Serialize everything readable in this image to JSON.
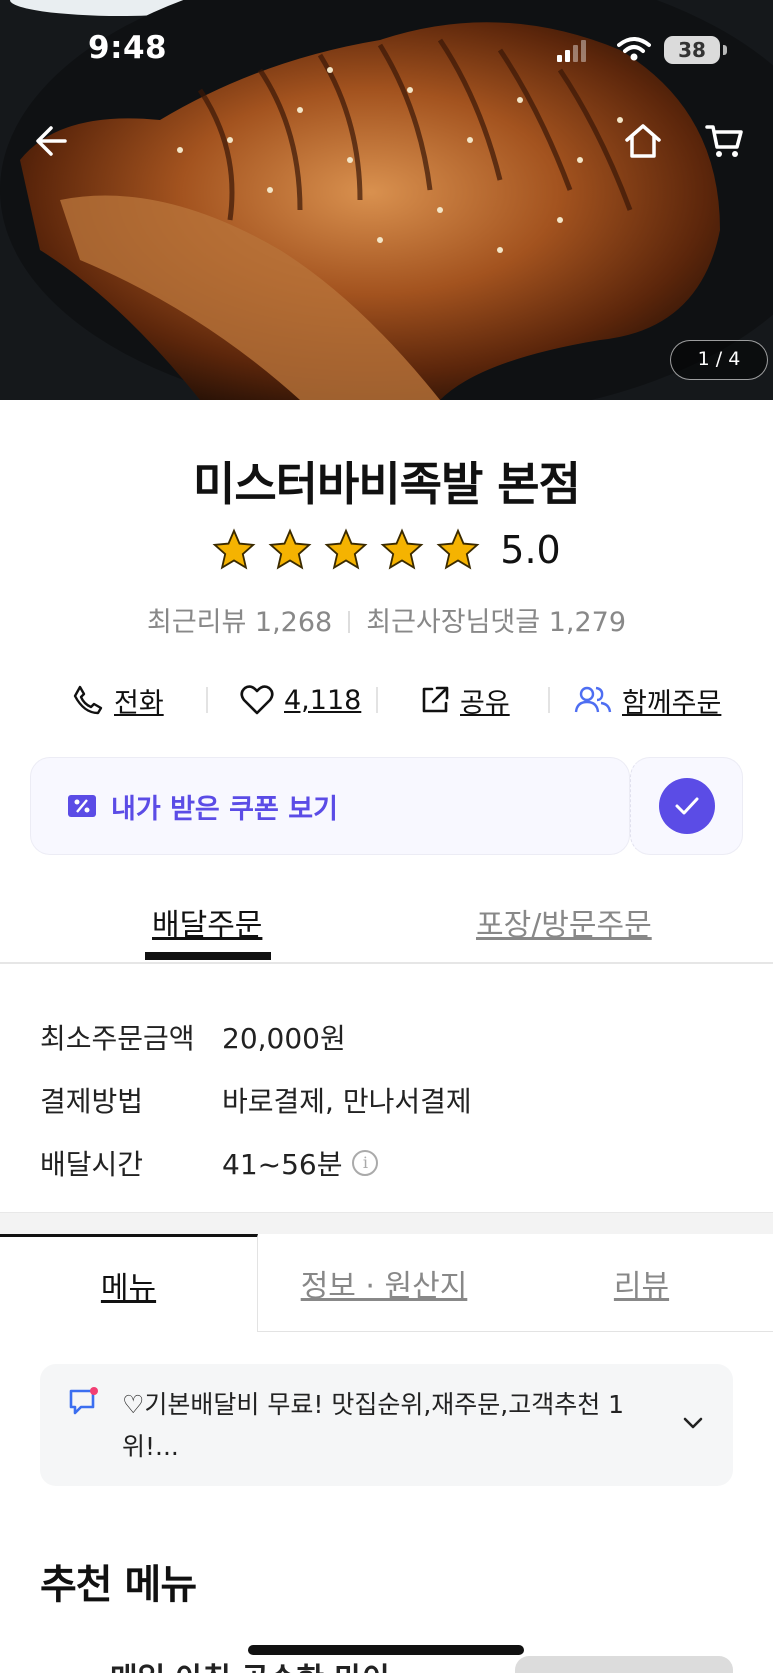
{
  "status_bar": {
    "time": "9:48",
    "battery": "38"
  },
  "hero": {
    "page_indicator": "1 / 4"
  },
  "store": {
    "name": "미스터바비족발 본점",
    "rating": "5.0",
    "stars": 5,
    "recent_reviews": "최근리뷰 1,268",
    "owner_replies": "최근사장님댓글 1,279"
  },
  "actions": {
    "call": "전화",
    "like_count": "4,118",
    "share": "공유",
    "group_order": "함께주문"
  },
  "coupon": {
    "label": "내가 받은 쿠폰 보기"
  },
  "order_tabs": {
    "delivery": "배달주문",
    "pickup": "포장/방문주문"
  },
  "info": [
    {
      "key": "최소주문금액",
      "value": "20,000원"
    },
    {
      "key": "결제방법",
      "value": "바로결제, 만나서결제"
    },
    {
      "key": "배달시간",
      "value": "41~56분"
    }
  ],
  "menu_tabs": {
    "menu": "메뉴",
    "info": "정보 · 원산지",
    "review": "리뷰"
  },
  "notice": {
    "text": "♡기본배달비 무료! 맛집순위,재주문,고객추천 1위!..."
  },
  "recommended": {
    "title": "추천 메뉴",
    "first_item_partial": "매일 아침 공수한 마이 ..."
  },
  "colors": {
    "accent": "#5b4ce6",
    "star": "#f5b301",
    "text_muted": "#888888"
  }
}
